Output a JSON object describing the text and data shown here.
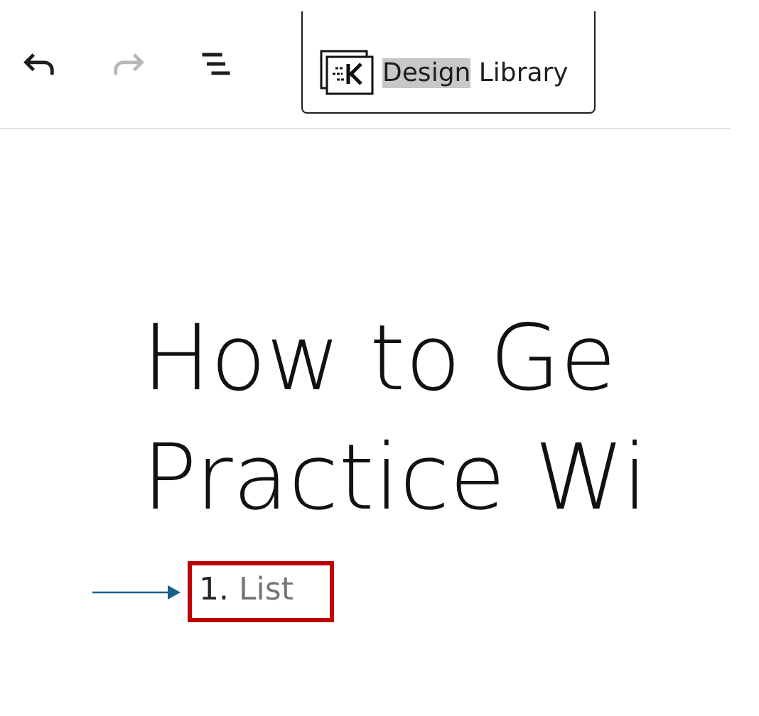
{
  "toolbar": {
    "buttons": [
      {
        "kind": "undo",
        "disabled": false
      },
      {
        "kind": "redo",
        "disabled": true
      },
      {
        "kind": "outline",
        "disabled": false
      }
    ],
    "design_library": {
      "label_parts": [
        {
          "text": "Design",
          "highlighted": true
        },
        {
          "text": "Library",
          "highlighted": false
        }
      ]
    }
  },
  "title_lines": [
    "How to Ge",
    "Practice Wi"
  ],
  "list_item": {
    "number": "1.",
    "placeholder": "List",
    "outlined": true
  },
  "annotation": {
    "kind": "arrow"
  }
}
